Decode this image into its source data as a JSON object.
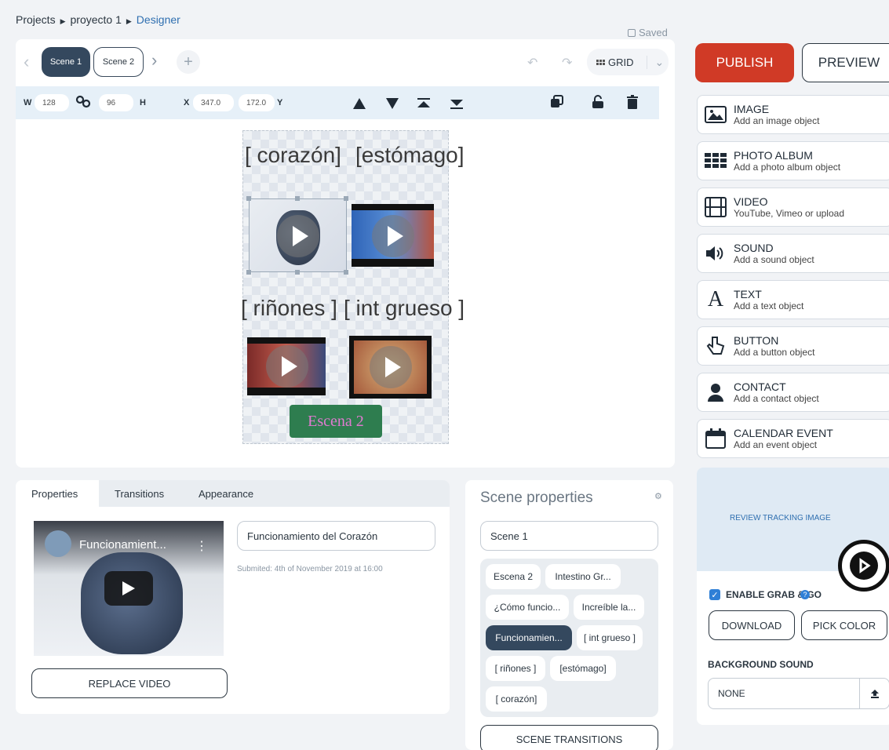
{
  "breadcrumb": {
    "projects": "Projects",
    "project": "proyecto 1",
    "current": "Designer",
    "sep": "▶"
  },
  "status": {
    "saved": "Saved"
  },
  "scenes": {
    "prev": "‹",
    "next": "›",
    "add": "+",
    "tabs": [
      {
        "label": "Scene 1"
      },
      {
        "label": "Scene 2"
      }
    ]
  },
  "top_controls": {
    "undo": "↶",
    "redo": "↷",
    "grid": "GRID",
    "chevron": "⌄"
  },
  "actions": {
    "publish": "PUBLISH",
    "preview": "PREVIEW"
  },
  "toolbar": {
    "w_label": "W",
    "w_value": "128",
    "h_label": "H",
    "h_value": "96",
    "x_label": "X",
    "x_value": "347.0",
    "y_label": "Y",
    "y_value": "172.0"
  },
  "canvas": {
    "labels": [
      "[ corazón]",
      "[estómago]",
      "[ riñones ]",
      "[ int grueso ]"
    ],
    "button": "Escena 2"
  },
  "objects": [
    {
      "title": "IMAGE",
      "subtitle": "Add an image object",
      "icon": "image-icon"
    },
    {
      "title": "PHOTO ALBUM",
      "subtitle": "Add a photo album object",
      "icon": "album-icon"
    },
    {
      "title": "VIDEO",
      "subtitle": "YouTube, Vimeo or upload",
      "icon": "film-icon"
    },
    {
      "title": "SOUND",
      "subtitle": "Add a sound object",
      "icon": "speaker-icon"
    },
    {
      "title": "TEXT",
      "subtitle": "Add a text object",
      "icon": "text-icon"
    },
    {
      "title": "BUTTON",
      "subtitle": "Add a button object",
      "icon": "pointer-icon"
    },
    {
      "title": "CONTACT",
      "subtitle": "Add a contact object",
      "icon": "person-icon"
    },
    {
      "title": "CALENDAR EVENT",
      "subtitle": "Add an event object",
      "icon": "calendar-icon"
    }
  ],
  "tracking": {
    "review": "REVIEW TRACKING IMAGE",
    "grab_go": "ENABLE GRAB & GO",
    "download": "DOWNLOAD",
    "pick_color": "PICK COLOR",
    "bg_sound_label": "BACKGROUND SOUND",
    "bg_sound_value": "NONE"
  },
  "properties": {
    "tabs": [
      "Properties",
      "Transitions",
      "Appearance"
    ],
    "video_title": "Funcionamient...",
    "name_value": "Funcionamiento del Corazón",
    "submitted": "Submited: 4th of November 2019 at 16:00",
    "replace": "REPLACE VIDEO"
  },
  "scene_properties": {
    "title": "Scene properties",
    "name_value": "Scene 1",
    "chips": [
      {
        "label": "Escena 2"
      },
      {
        "label": "Intestino Gr..."
      },
      {
        "label": "¿Cómo funcio..."
      },
      {
        "label": "Increíble la..."
      },
      {
        "label": "Funcionamien..."
      },
      {
        "label": "[ int grueso ]"
      },
      {
        "label": "[ riñones ]"
      },
      {
        "label": "[estómago]"
      },
      {
        "label": "[ corazón]"
      }
    ],
    "transitions": "SCENE TRANSITIONS"
  },
  "colors": {
    "publish": "#d03a26",
    "scene_active": "#34485e",
    "escena_btn": "#2e7d4f",
    "escena_text": "#e07ad0"
  }
}
